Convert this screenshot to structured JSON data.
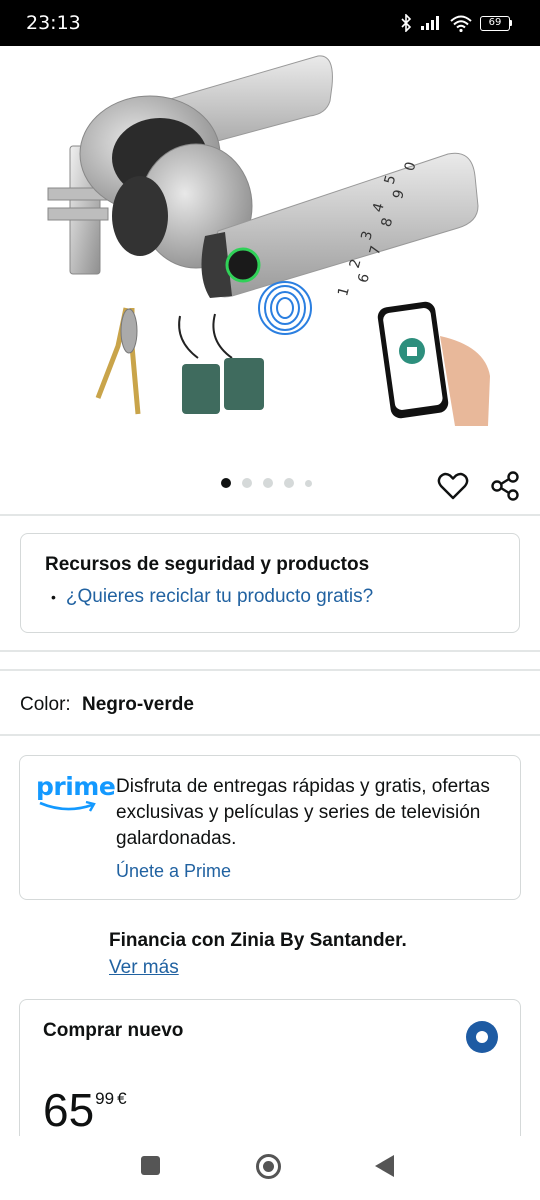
{
  "status_bar": {
    "time": "23:13",
    "battery": "69",
    "icons": [
      "bluetooth-icon",
      "signal-icon",
      "wifi-icon",
      "battery-icon"
    ]
  },
  "product_image": {
    "keypad_digits": [
      "1",
      "2",
      "3",
      "4",
      "5",
      "6",
      "7",
      "8",
      "9",
      "0"
    ]
  },
  "carousel": {
    "count": 5,
    "active_index": 0
  },
  "actions": {
    "icons": [
      "heart-icon",
      "share-icon"
    ]
  },
  "recursos": {
    "title": "Recursos de seguridad y productos",
    "bullet": "•",
    "link": "¿Quieres reciclar tu producto gratis?"
  },
  "color": {
    "label": "Color:",
    "value": "Negro-verde"
  },
  "prime": {
    "logo_text": "prime",
    "description": "Disfruta de entregas rápidas y gratis, ofertas exclusivas y películas y series de televisión galardonadas.",
    "link": "Únete a Prime",
    "brand_color": "#1399ff"
  },
  "financia": {
    "title": "Financia con Zinia By Santander.",
    "link": "Ver más"
  },
  "comprar": {
    "title": "Comprar nuevo",
    "price_whole": "65",
    "price_fraction": "99",
    "currency": "€",
    "selected": true
  },
  "nav_bar": {
    "icons": [
      "recents-icon",
      "home-icon",
      "back-icon"
    ]
  },
  "colors": {
    "link": "#2162a1",
    "text": "#0f1111",
    "radio": "#1e5ba3"
  }
}
